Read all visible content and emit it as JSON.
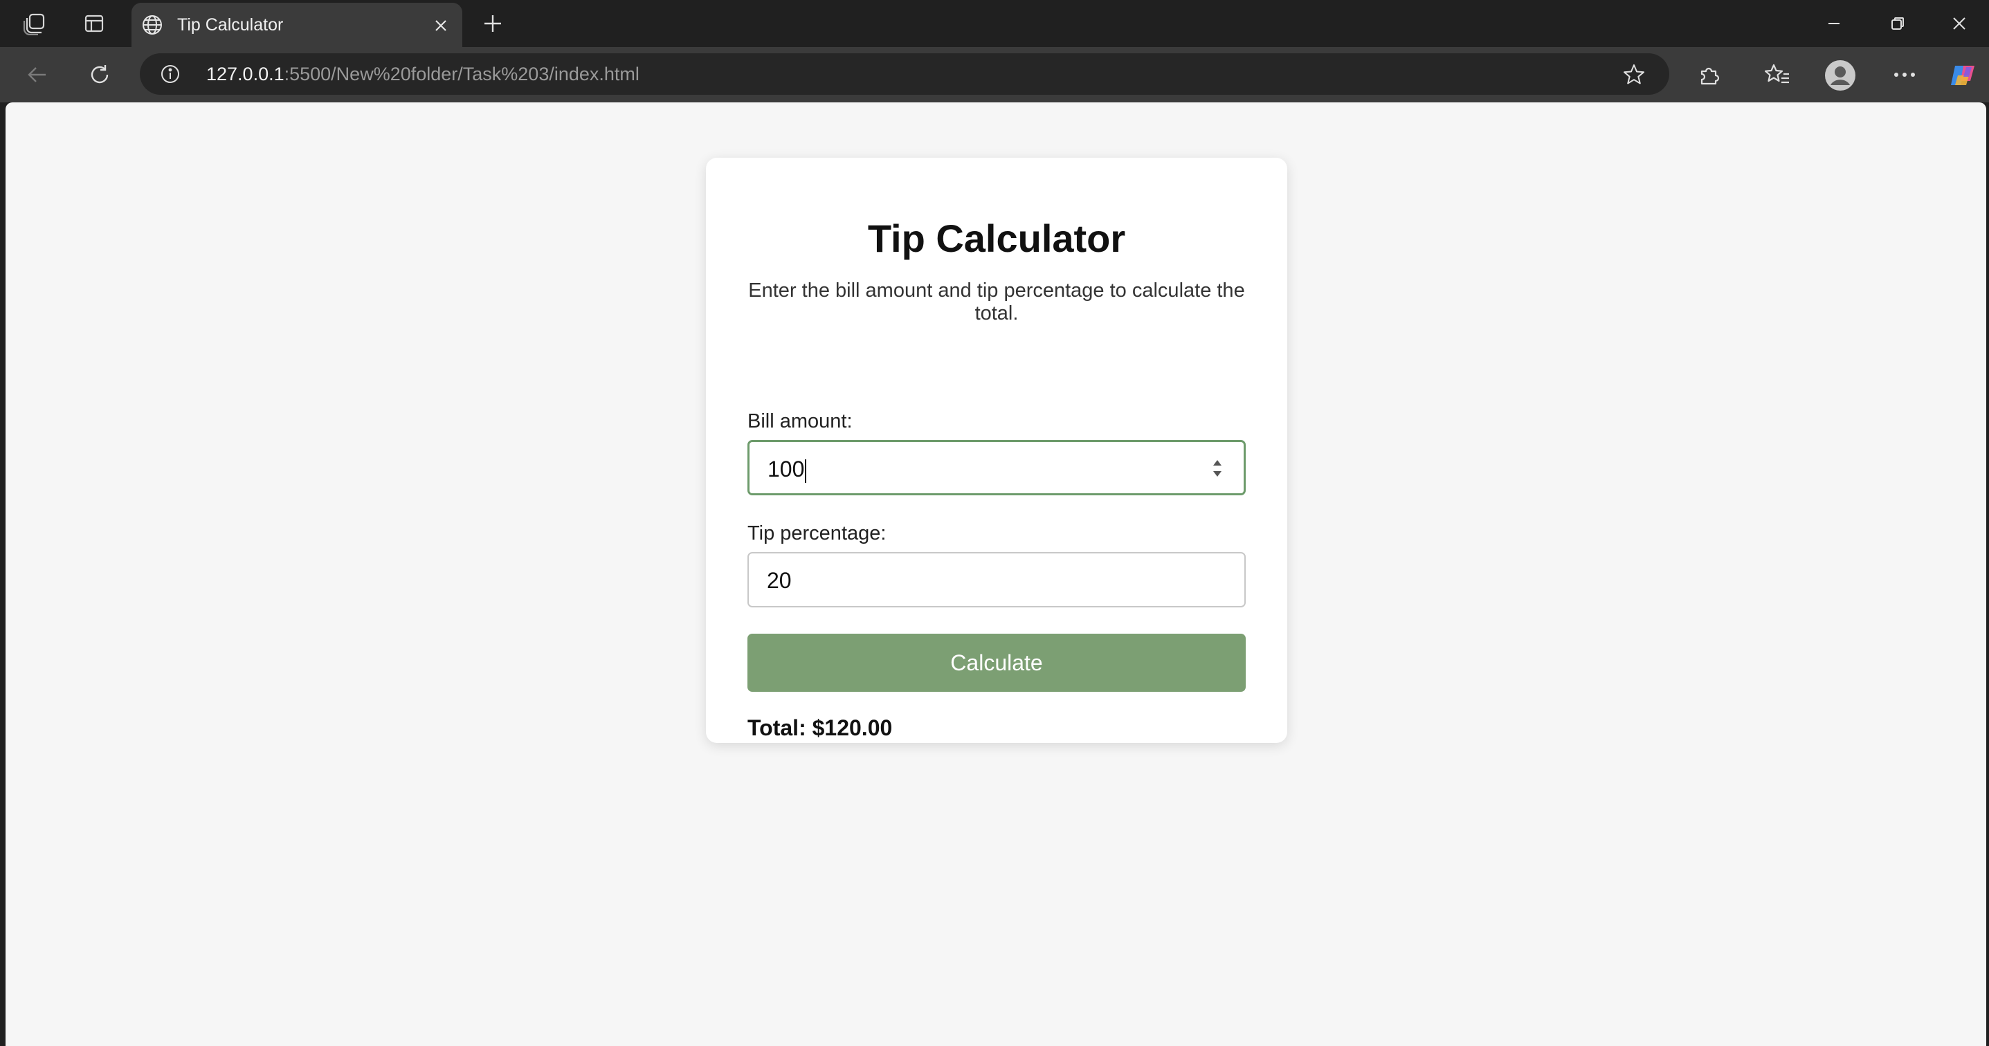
{
  "browser": {
    "tab_title": "Tip Calculator",
    "url_host": "127.0.0.1",
    "url_rest": ":5500/New%20folder/Task%203/index.html"
  },
  "page": {
    "heading": "Tip Calculator",
    "description": "Enter the bill amount and tip percentage to calculate the total.",
    "bill_label": "Bill amount:",
    "bill_value": "100",
    "tip_label": "Tip percentage:",
    "tip_value": "20",
    "calculate_label": "Calculate",
    "total_text": "Total: $120.00"
  },
  "colors": {
    "accent": "#7c9f73",
    "focus_border": "#6d9b6b",
    "page_background": "#f6f6f6",
    "chrome_dark": "#202020"
  }
}
